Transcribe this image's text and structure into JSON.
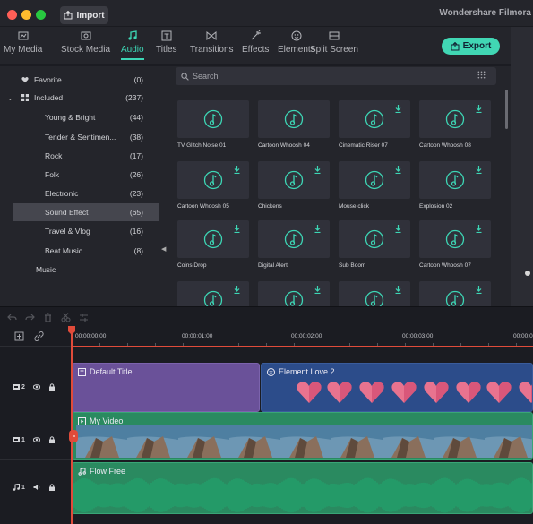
{
  "titlebar": {
    "import_label": "Import",
    "app_title": "Wondershare Filmora",
    "traffic_colors": [
      "#ff5f57",
      "#febc2e",
      "#28c840"
    ]
  },
  "media_tabs": [
    {
      "label": "My Media",
      "icon": "folder-icon"
    },
    {
      "label": "Stock Media",
      "icon": "stock-media-icon"
    },
    {
      "label": "Audio",
      "icon": "music-note-icon",
      "active": true
    },
    {
      "label": "Titles",
      "icon": "titles-icon"
    },
    {
      "label": "Transitions",
      "icon": "transitions-icon"
    },
    {
      "label": "Effects",
      "icon": "effects-icon"
    },
    {
      "label": "Elements",
      "icon": "elements-icon"
    },
    {
      "label": "Split Screen",
      "icon": "split-screen-icon"
    }
  ],
  "export_label": "Export",
  "accent_color": "#3dd6b5",
  "categories": [
    {
      "label": "Favorite",
      "count": "(0)",
      "icon": "heart-icon"
    },
    {
      "label": "Included",
      "count": "(237)",
      "icon": "grid-icon",
      "expanded": true
    },
    {
      "label": "Young & Bright",
      "count": "(44)"
    },
    {
      "label": "Tender & Sentimen...",
      "count": "(38)"
    },
    {
      "label": "Rock",
      "count": "(17)"
    },
    {
      "label": "Folk",
      "count": "(26)"
    },
    {
      "label": "Electronic",
      "count": "(23)"
    },
    {
      "label": "Sound Effect",
      "count": "(65)",
      "active": true
    },
    {
      "label": "Travel & Vlog",
      "count": "(16)"
    },
    {
      "label": "Beat Music",
      "count": "(8)"
    },
    {
      "label": "Music",
      "count": ""
    }
  ],
  "search": {
    "placeholder": "Search"
  },
  "audio_items": [
    {
      "label": "TV Glitch Noise 01",
      "download": false
    },
    {
      "label": "Cartoon Whoosh 04",
      "download": false
    },
    {
      "label": "Cinematic Riser 07",
      "download": true
    },
    {
      "label": "Cartoon Whoosh 08",
      "download": true
    },
    {
      "label": "Cartoon Whoosh 05",
      "download": true
    },
    {
      "label": "Chickens",
      "download": true
    },
    {
      "label": "Mouse click",
      "download": true
    },
    {
      "label": "Explosion 02",
      "download": true
    },
    {
      "label": "Coins Drop",
      "download": true
    },
    {
      "label": "Digital Alert",
      "download": true
    },
    {
      "label": "Sub Boom",
      "download": true
    },
    {
      "label": "Cartoon Whoosh 07",
      "download": true
    },
    {
      "label": "",
      "download": true
    },
    {
      "label": "",
      "download": true
    },
    {
      "label": "",
      "download": true
    },
    {
      "label": "",
      "download": true
    }
  ],
  "timeline": {
    "timecodes": [
      "00:00:00:00",
      "00:00:01:00",
      "00:00:02:00",
      "00:00:03:00",
      "00:00:0"
    ],
    "tracks": [
      {
        "number": "2",
        "type": "video"
      },
      {
        "number": "1",
        "type": "video"
      },
      {
        "number": "1",
        "type": "audio"
      }
    ],
    "clips": {
      "title": "Default Title",
      "element": "Element Love 2",
      "video": "My Video",
      "audio": "Flow Free"
    }
  }
}
